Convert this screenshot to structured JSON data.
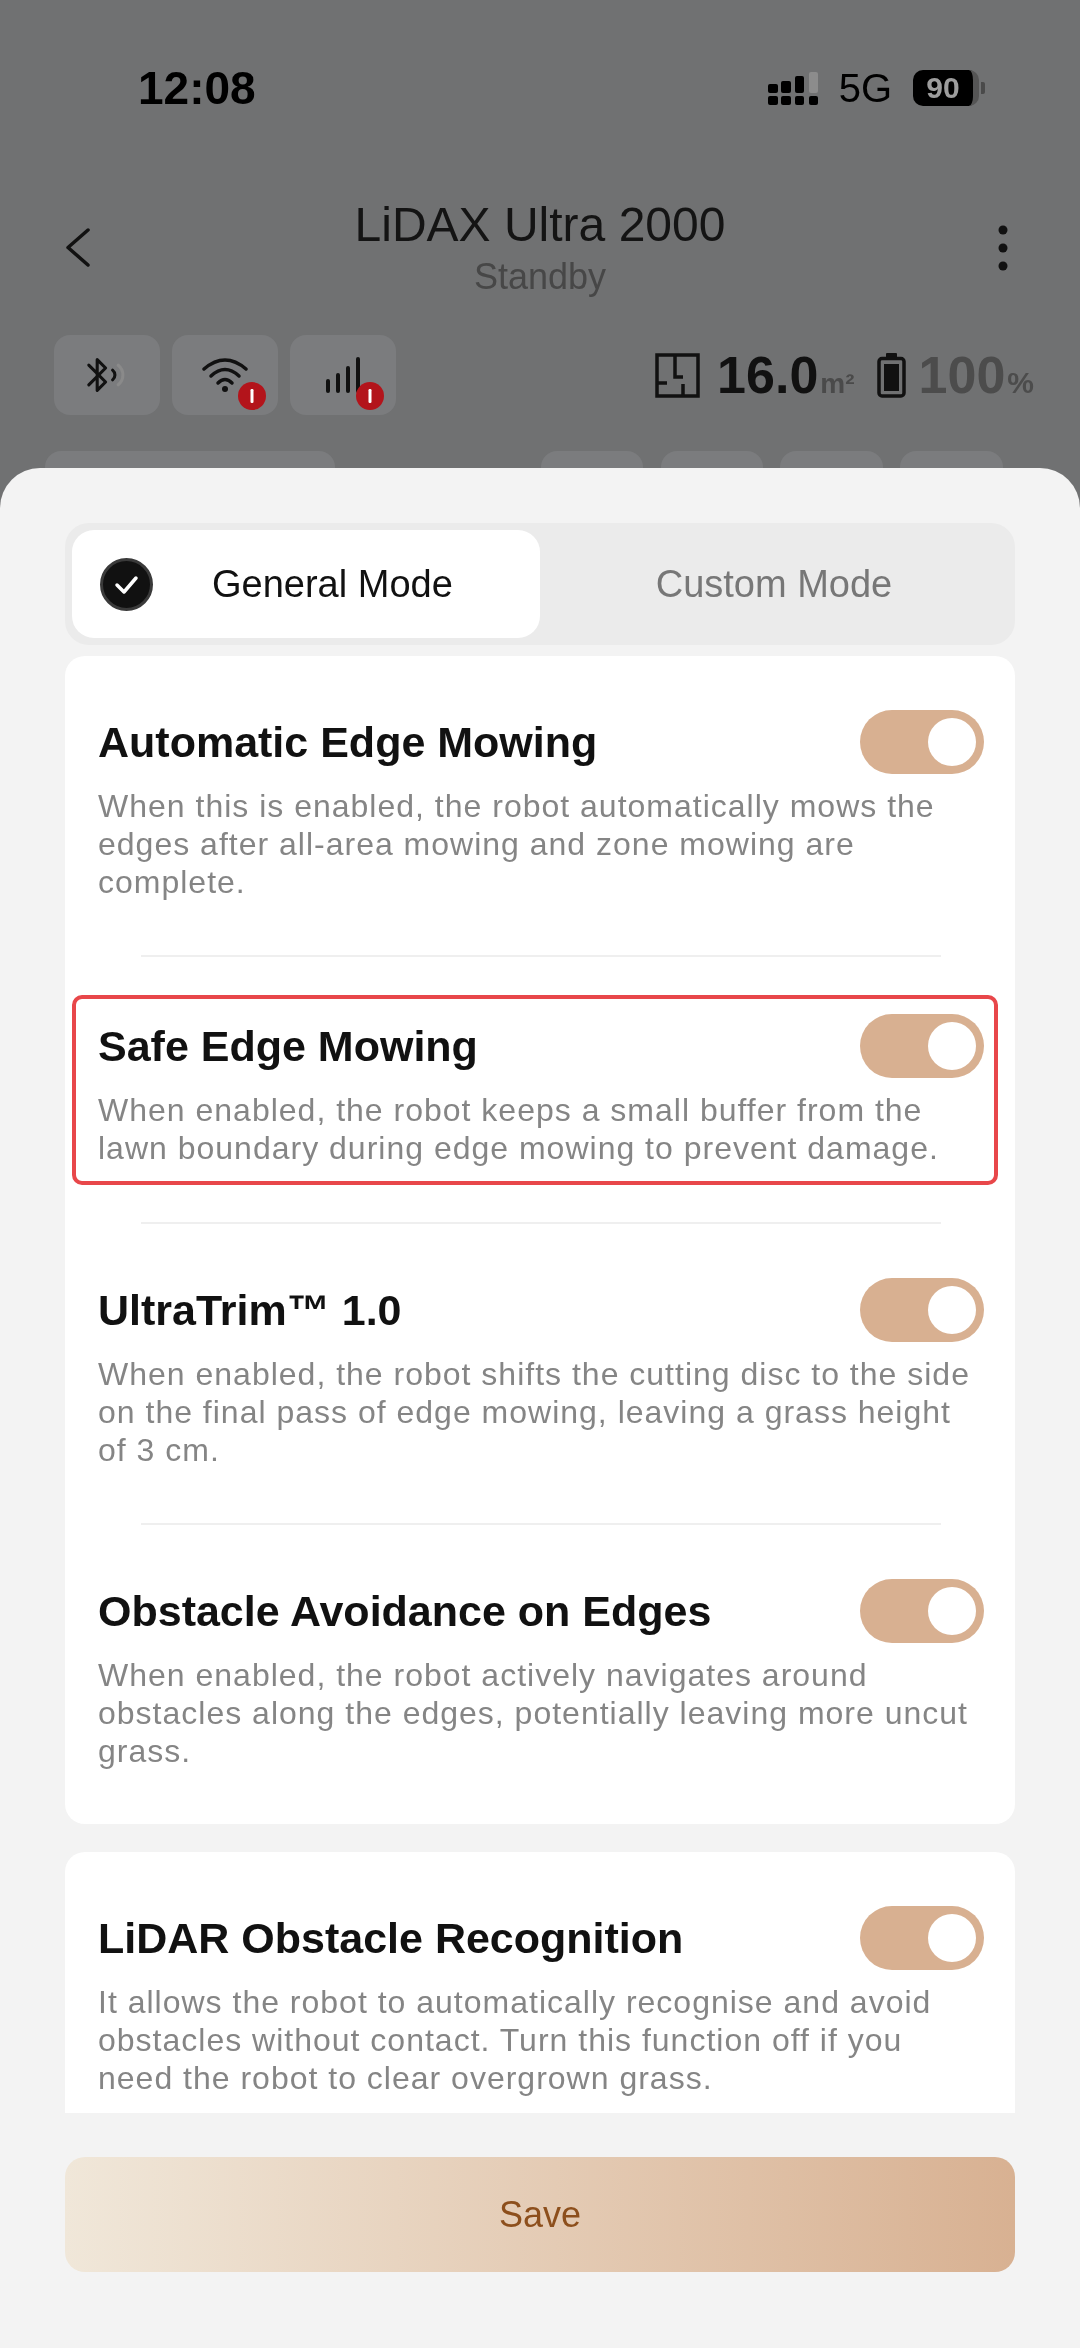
{
  "status_bar": {
    "time": "12:08",
    "network": "5G",
    "battery": "90"
  },
  "header": {
    "title": "LiDAX Ultra 2000",
    "subtitle": "Standby"
  },
  "connection_chips": [
    {
      "kind": "bluetooth",
      "alert": false
    },
    {
      "kind": "wifi",
      "alert": true
    },
    {
      "kind": "cellular",
      "alert": true
    }
  ],
  "stats": {
    "area": "16.0",
    "area_unit": "m²",
    "battery": "100",
    "battery_unit": "%"
  },
  "mode_tabs": [
    {
      "label": "General Mode",
      "selected": true
    },
    {
      "label": "Custom Mode",
      "selected": false
    }
  ],
  "setting_groups": [
    {
      "settings": [
        {
          "title": "Automatic Edge Mowing",
          "description": "When this is enabled, the robot automatically mows the edges after all-area mowing and zone mowing are complete.",
          "on": true,
          "highlighted": false
        },
        {
          "title": "Safe Edge Mowing",
          "description": "When enabled, the robot keeps a small buffer from the lawn boundary during edge mowing to prevent damage.",
          "on": true,
          "highlighted": true
        },
        {
          "title": "UltraTrim™ 1.0",
          "description": "When enabled, the robot shifts the cutting disc to the side on the final pass of edge mowing, leaving a grass height of 3 cm.",
          "on": true,
          "highlighted": false
        },
        {
          "title": "Obstacle Avoidance on Edges",
          "description": "When enabled, the robot actively navigates around obstacles along the edges, potentially leaving more uncut grass.",
          "on": true,
          "highlighted": false
        }
      ]
    },
    {
      "settings": [
        {
          "title": "LiDAR Obstacle Recognition",
          "description": "It allows the robot to automatically recognise and avoid obstacles without contact. Turn this function off if you need the robot to clear overgrown grass.",
          "on": true,
          "highlighted": false
        }
      ]
    }
  ],
  "save_button": "Save"
}
